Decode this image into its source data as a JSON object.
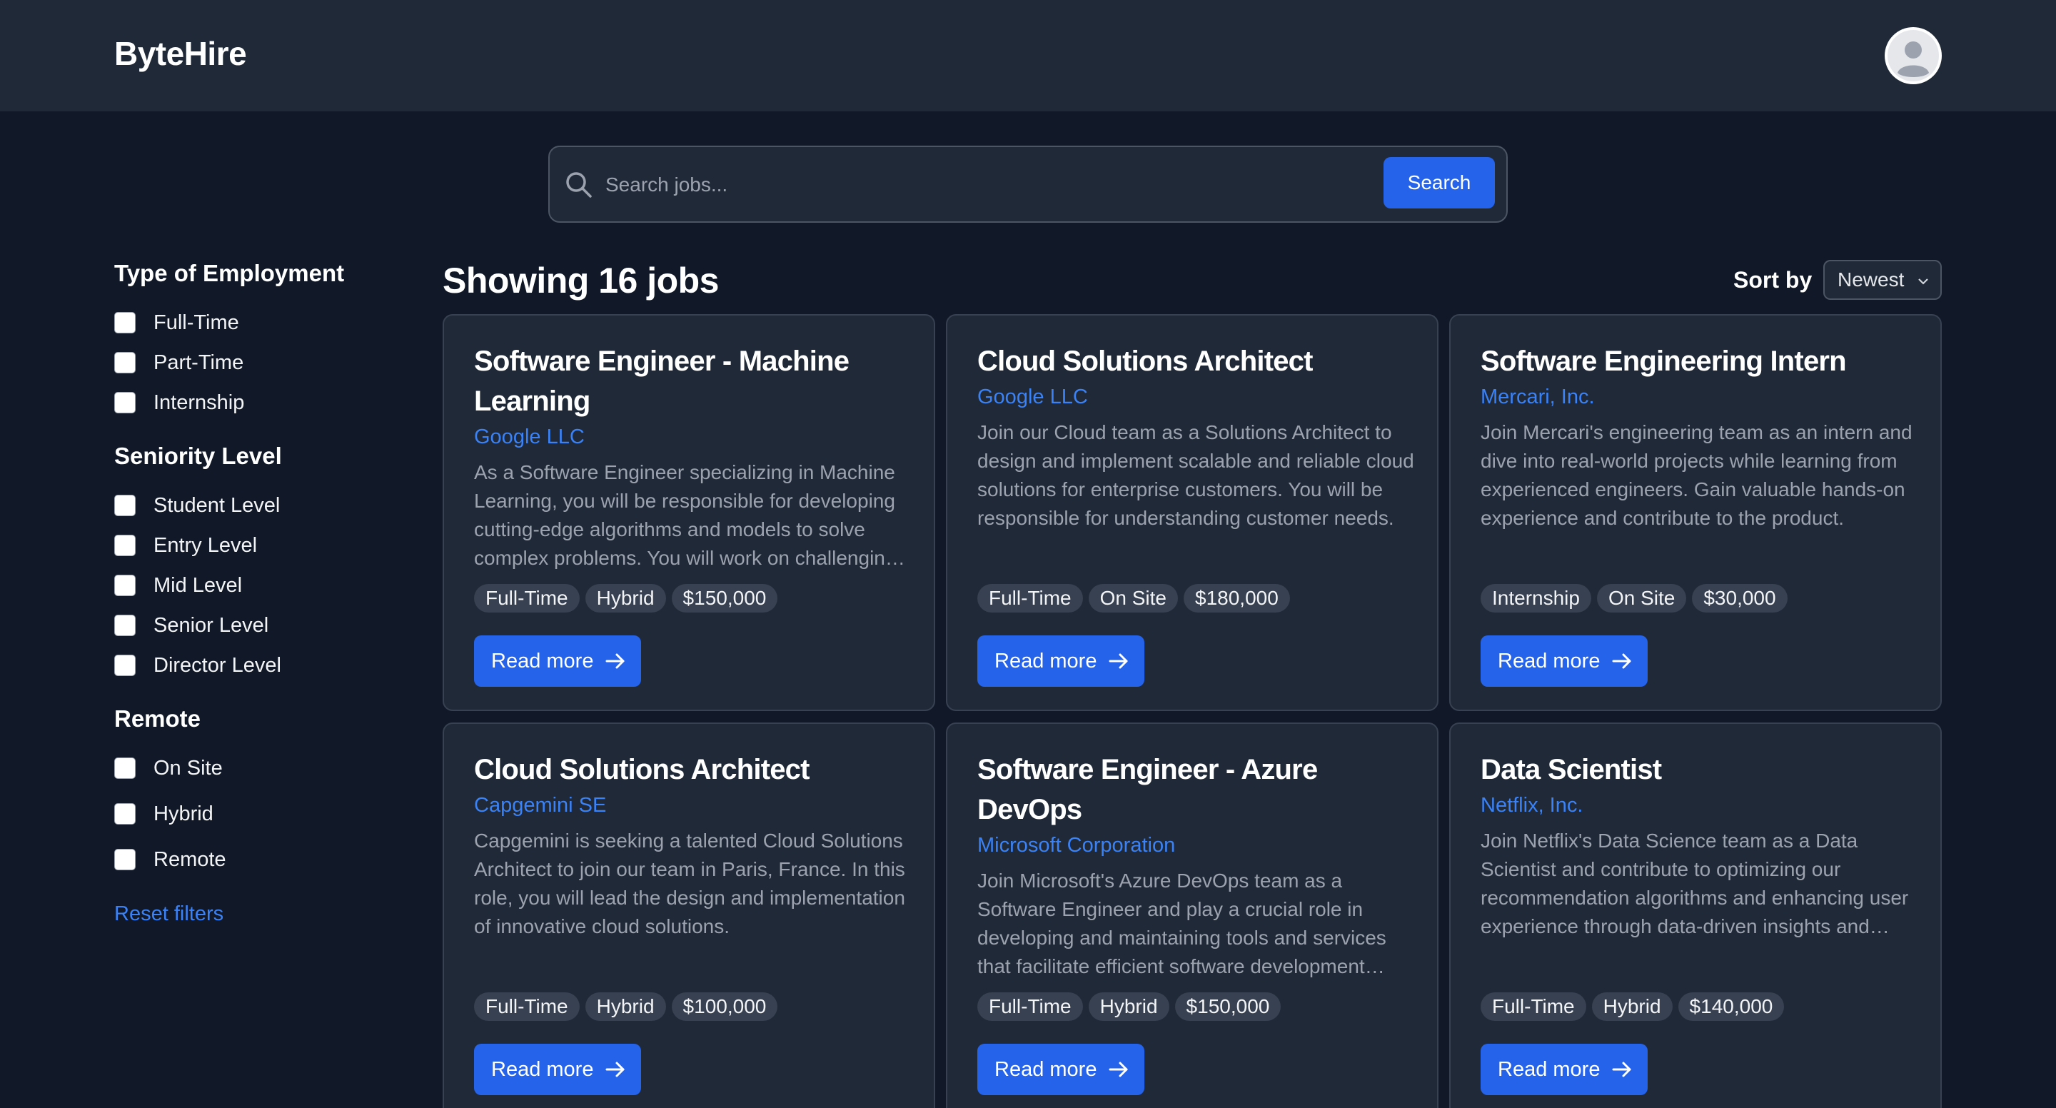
{
  "app": {
    "brand": "ByteHire"
  },
  "search": {
    "placeholder": "Search jobs...",
    "button_label": "Search"
  },
  "filters": {
    "employment": {
      "title": "Type of Employment",
      "options": [
        "Full-Time",
        "Part-Time",
        "Internship"
      ]
    },
    "seniority": {
      "title": "Seniority Level",
      "options": [
        "Student Level",
        "Entry Level",
        "Mid Level",
        "Senior Level",
        "Director Level"
      ]
    },
    "remote": {
      "title": "Remote",
      "options": [
        "On Site",
        "Hybrid",
        "Remote"
      ]
    },
    "reset_label": "Reset filters"
  },
  "results": {
    "heading": "Showing 16 jobs",
    "sort_label": "Sort by",
    "sort_value": "Newest"
  },
  "jobs": [
    {
      "title": "Software Engineer - Machine Learning",
      "company": "Google LLC",
      "description": "As a Software Engineer specializing in Machine Learning, you will be responsible for developing cutting-edge algorithms and models to solve complex problems. You will work on challenging projects.",
      "tags": [
        "Full-Time",
        "Hybrid",
        "$150,000"
      ],
      "cta": "Read more"
    },
    {
      "title": "Cloud Solutions Architect",
      "company": "Google LLC",
      "description": "Join our Cloud team as a Solutions Architect to design and implement scalable and reliable cloud solutions for enterprise customers. You will be responsible for understanding customer needs.",
      "tags": [
        "Full-Time",
        "On Site",
        "$180,000"
      ],
      "cta": "Read more"
    },
    {
      "title": "Software Engineering Intern",
      "company": "Mercari, Inc.",
      "description": "Join Mercari's engineering team as an intern and dive into real-world projects while learning from experienced engineers. Gain valuable hands-on experience and contribute to the product.",
      "tags": [
        "Internship",
        "On Site",
        "$30,000"
      ],
      "cta": "Read more"
    },
    {
      "title": "Cloud Solutions Architect",
      "company": "Capgemini SE",
      "description": "Capgemini is seeking a talented Cloud Solutions Architect to join our team in Paris, France. In this role, you will lead the design and implementation of innovative cloud solutions.",
      "tags": [
        "Full-Time",
        "Hybrid",
        "$100,000"
      ],
      "cta": "Read more"
    },
    {
      "title": "Software Engineer - Azure DevOps",
      "company": "Microsoft Corporation",
      "description": "Join Microsoft's Azure DevOps team as a Software Engineer and play a crucial role in developing and maintaining tools and services that facilitate efficient software development workflows.",
      "tags": [
        "Full-Time",
        "Hybrid",
        "$150,000"
      ],
      "cta": "Read more"
    },
    {
      "title": "Data Scientist",
      "company": "Netflix, Inc.",
      "description": "Join Netflix's Data Science team as a Data Scientist and contribute to optimizing our recommendation algorithms and enhancing user experience through data-driven insights and experiments.",
      "tags": [
        "Full-Time",
        "Hybrid",
        "$140,000"
      ],
      "cta": "Read more"
    }
  ]
}
